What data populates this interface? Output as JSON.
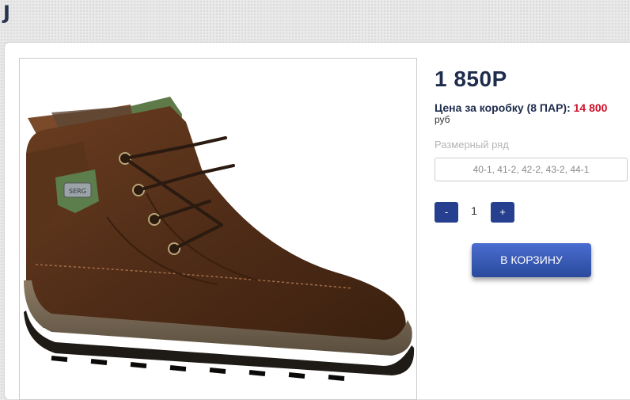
{
  "header": {
    "logo_text": "J"
  },
  "product": {
    "image_alt": "brown leather boot",
    "tag_text": "SERG",
    "price": "1 850Р",
    "box_price_label": "Цена за коробку (8 ПАР):",
    "box_price_value": "14 800",
    "currency": "руб",
    "size_label": "Размерный ряд",
    "size_value": "40-1, 41-2, 42-2, 43-2, 44-1",
    "quantity": {
      "minus_label": "-",
      "value": "1",
      "plus_label": "+"
    },
    "cart_button_label": "В КОРЗИНУ"
  },
  "colors": {
    "accent": "#263f8f",
    "price_text": "#1f2d4d",
    "highlight": "#d0102a"
  }
}
